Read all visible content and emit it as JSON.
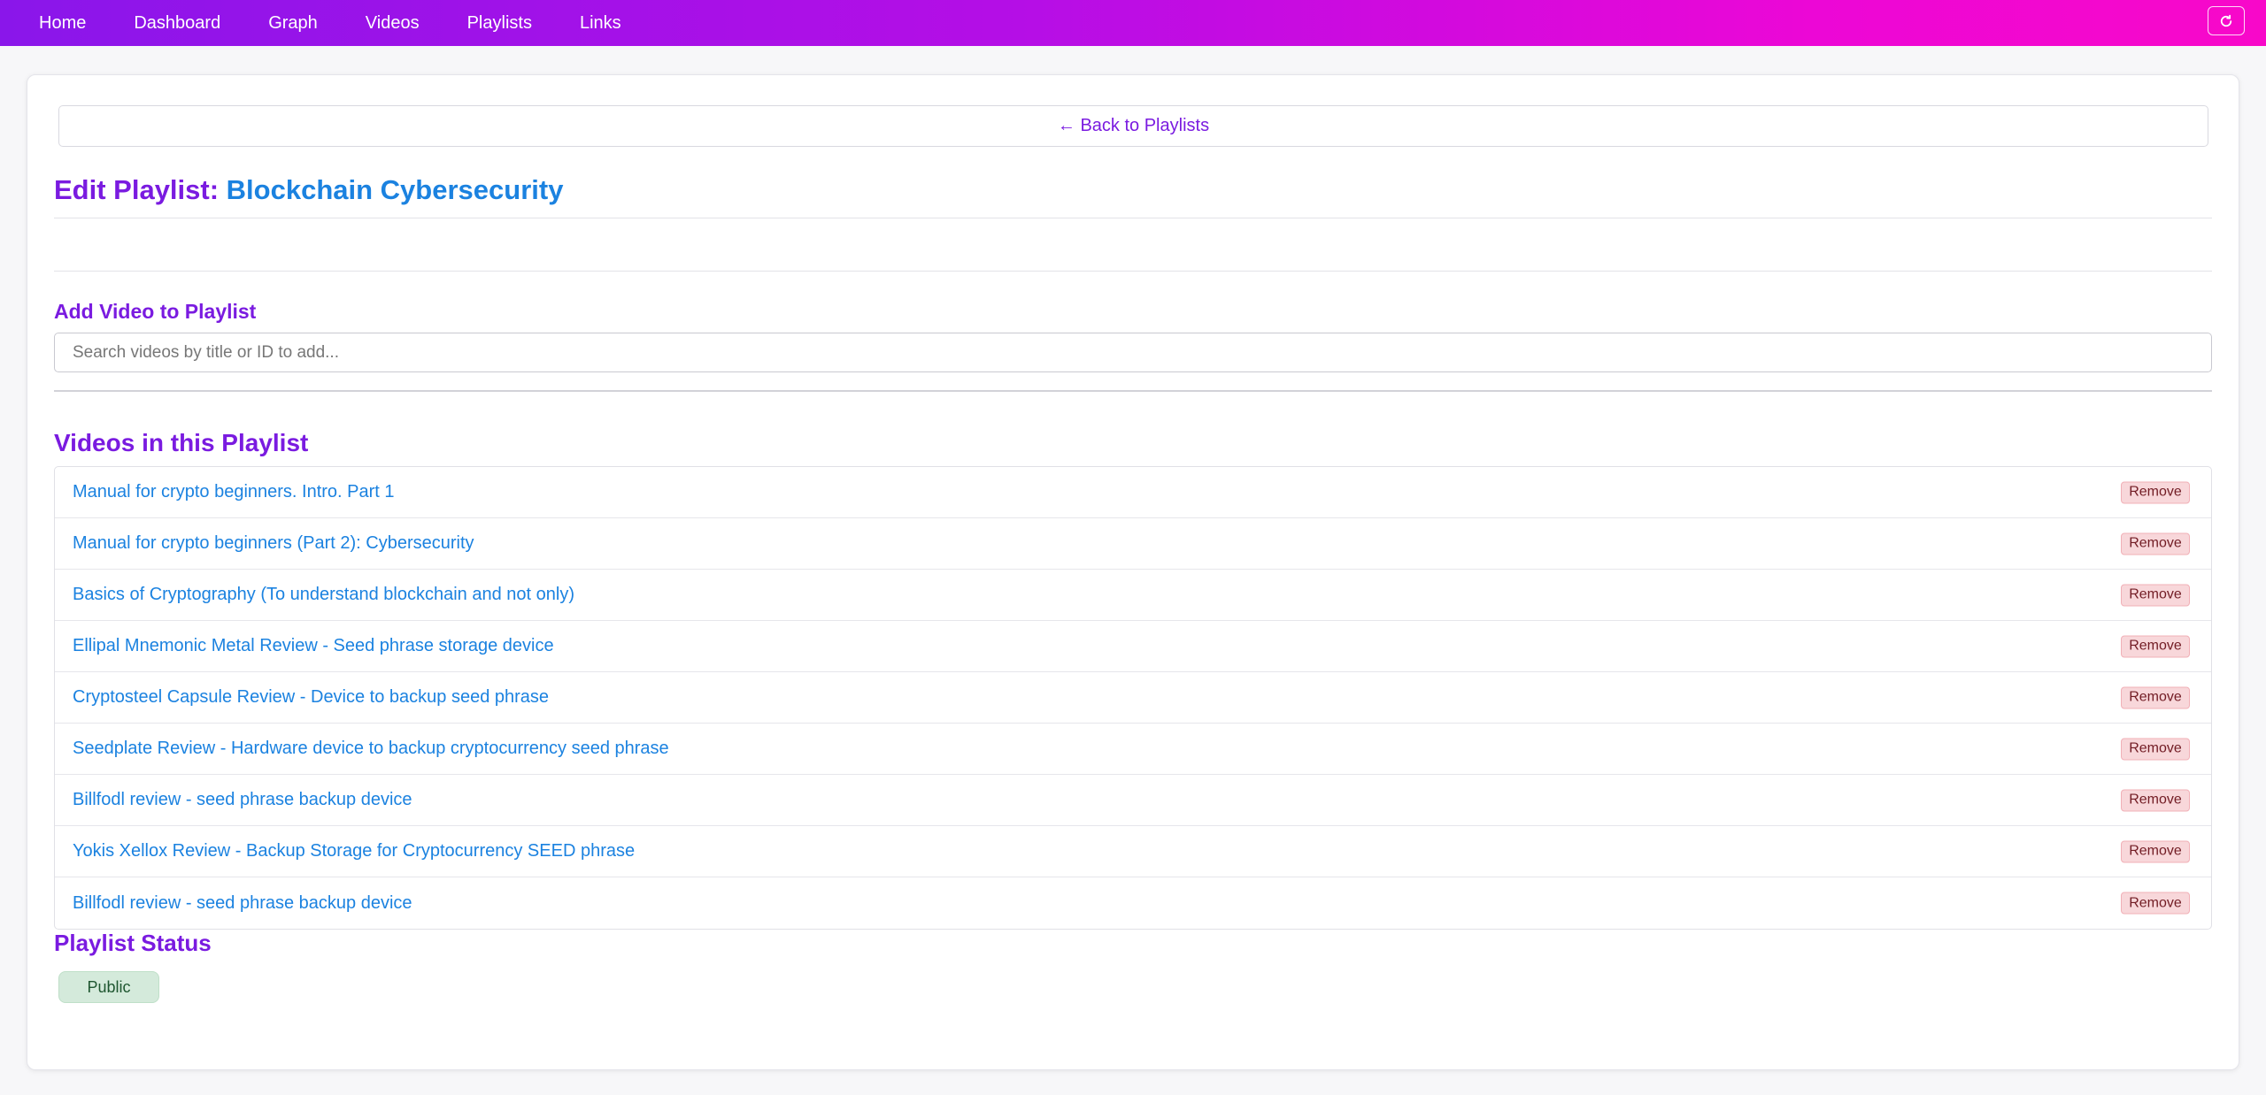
{
  "nav": {
    "items": [
      {
        "label": "Home"
      },
      {
        "label": "Dashboard"
      },
      {
        "label": "Graph"
      },
      {
        "label": "Videos"
      },
      {
        "label": "Playlists"
      },
      {
        "label": "Links"
      }
    ],
    "refresh_icon": "refresh-icon"
  },
  "back_label": "← Back to Playlists",
  "title": {
    "prefix": "Edit Playlist: ",
    "playlist_name": "Blockchain Cybersecurity"
  },
  "add_video": {
    "heading": "Add Video to Playlist",
    "placeholder": "Search videos by title or ID to add..."
  },
  "videos": {
    "heading": "Videos in this Playlist",
    "remove_label": "Remove",
    "items": [
      {
        "title": "Manual for crypto beginners. Intro. Part 1"
      },
      {
        "title": "Manual for crypto beginners (Part 2): Cybersecurity"
      },
      {
        "title": "Basics of Cryptography (To understand blockchain and not only)"
      },
      {
        "title": "Ellipal Mnemonic Metal Review - Seed phrase storage device"
      },
      {
        "title": "Cryptosteel Capsule Review - Device to backup seed phrase"
      },
      {
        "title": "Seedplate Review - Hardware device to backup cryptocurrency seed phrase"
      },
      {
        "title": "Billfodl review - seed phrase backup device"
      },
      {
        "title": "Yokis Xellox Review - Backup Storage for Cryptocurrency SEED phrase"
      },
      {
        "title": "Billfodl review - seed phrase backup device"
      }
    ]
  },
  "status": {
    "heading": "Playlist Status",
    "value": "Public"
  },
  "colors": {
    "accent_purple": "#7a1be0",
    "link_blue": "#1b82e0",
    "nav_gradient_start": "#8a16ea",
    "nav_gradient_end": "#f808c9",
    "remove_bg": "#f8d7da",
    "status_bg": "#d4eadb"
  }
}
